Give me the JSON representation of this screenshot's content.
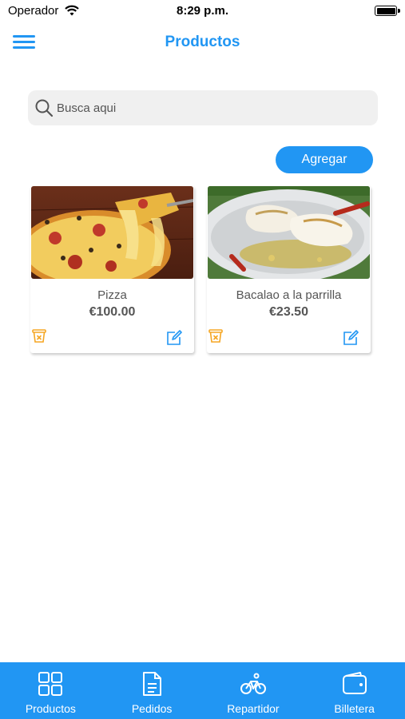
{
  "status_bar": {
    "carrier": "Operador",
    "time": "8:29 p.m."
  },
  "header": {
    "title": "Productos",
    "menu_icon": "hamburger-menu-icon"
  },
  "search": {
    "placeholder": "Busca aqui",
    "value": ""
  },
  "actions": {
    "add_label": "Agregar"
  },
  "products": [
    {
      "name": "Pizza",
      "price": "€100.00",
      "image": "pizza-photo"
    },
    {
      "name": "Bacalao a la parrilla",
      "price": "€23.50",
      "image": "grilled-cod-photo"
    }
  ],
  "tabs": [
    {
      "label": "Productos",
      "icon": "grid-icon"
    },
    {
      "label": "Pedidos",
      "icon": "document-icon"
    },
    {
      "label": "Repartidor",
      "icon": "bicycle-icon"
    },
    {
      "label": "Billetera",
      "icon": "wallet-icon"
    }
  ],
  "colors": {
    "accent": "#2196f3",
    "delete": "#f5a623",
    "background": "#ffffff"
  }
}
